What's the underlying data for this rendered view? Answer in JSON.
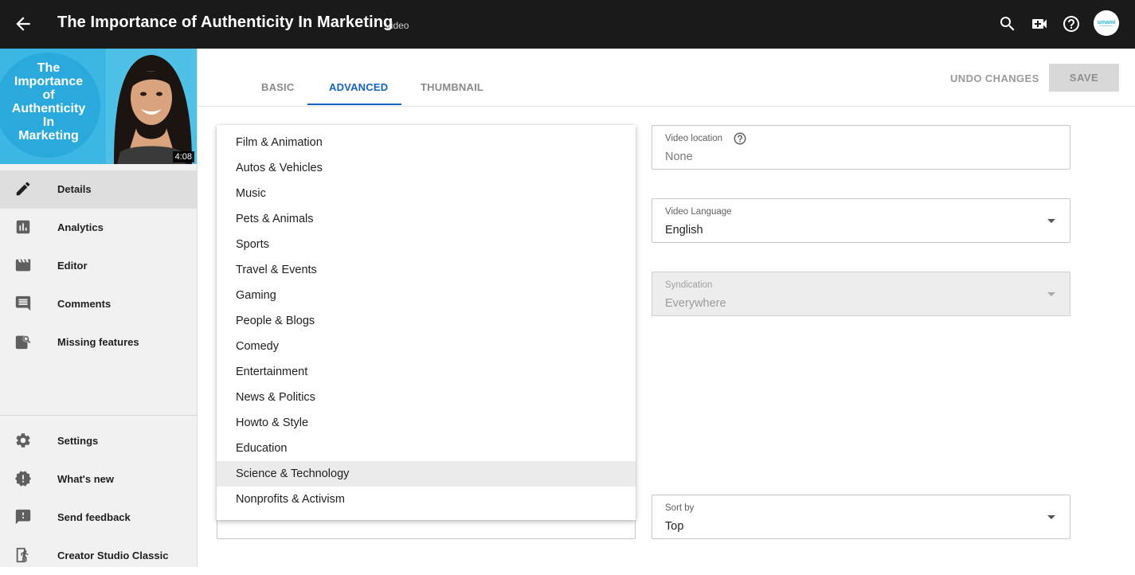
{
  "header": {
    "title": "The Importance of Authenticity In Marketing",
    "subtitle": "Video",
    "avatar_text": "umami"
  },
  "thumbnail": {
    "title_lines": [
      "The",
      "Importance",
      "of",
      "Authenticity",
      "In",
      "Marketing"
    ],
    "duration": "4:08"
  },
  "sidebar": {
    "items": [
      {
        "label": "Details",
        "icon": "pencil-icon"
      },
      {
        "label": "Analytics",
        "icon": "bar-chart-icon"
      },
      {
        "label": "Editor",
        "icon": "clapperboard-icon"
      },
      {
        "label": "Comments",
        "icon": "comment-icon"
      },
      {
        "label": "Missing features",
        "icon": "search-document-icon"
      }
    ],
    "bottom_items": [
      {
        "label": "Settings",
        "icon": "gear-icon"
      },
      {
        "label": "What's new",
        "icon": "alert-badge-icon"
      },
      {
        "label": "Send feedback",
        "icon": "feedback-icon"
      },
      {
        "label": "Creator Studio Classic",
        "icon": "exit-person-icon"
      }
    ]
  },
  "tabs": [
    {
      "label": "BASIC"
    },
    {
      "label": "ADVANCED"
    },
    {
      "label": "THUMBNAIL"
    }
  ],
  "actions": {
    "undo_label": "UNDO CHANGES",
    "save_label": "SAVE"
  },
  "category_menu": {
    "items": [
      "Film & Animation",
      "Autos & Vehicles",
      "Music",
      "Pets & Animals",
      "Sports",
      "Travel & Events",
      "Gaming",
      "People & Blogs",
      "Comedy",
      "Entertainment",
      "News & Politics",
      "Howto & Style",
      "Education",
      "Science & Technology",
      "Nonprofits & Activism"
    ],
    "selected": "Science & Technology"
  },
  "fields": {
    "video_location": {
      "label": "Video location",
      "value": "None"
    },
    "video_language": {
      "label": "Video Language",
      "value": "English"
    },
    "syndication": {
      "label": "Syndication",
      "value": "Everywhere"
    },
    "sort_by": {
      "label": "Sort by",
      "value": "Top"
    }
  },
  "colors": {
    "topbar": "#1a1a1a",
    "accent": "#1565c0",
    "sidebar": "#f1f1f1"
  }
}
